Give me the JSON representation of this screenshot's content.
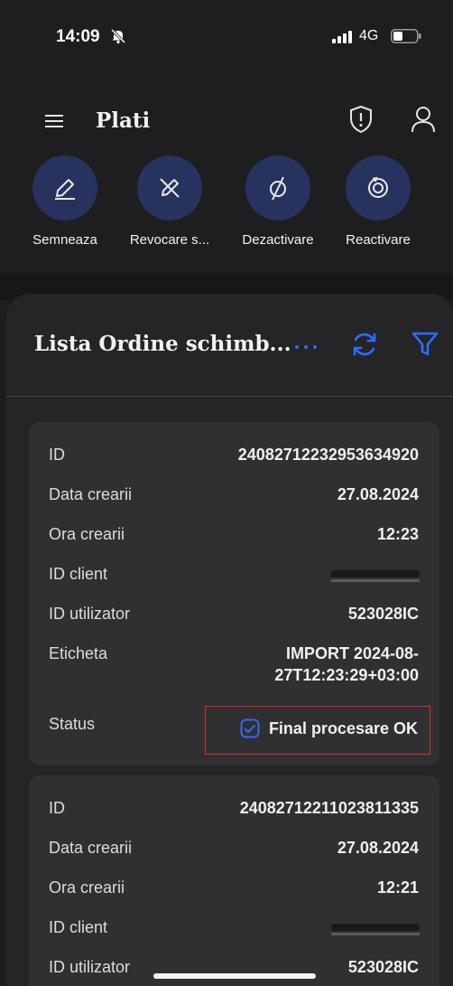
{
  "status_bar": {
    "time": "14:09",
    "network": "4G"
  },
  "header": {
    "title": "Plati"
  },
  "actions": [
    {
      "label": "Semneaza",
      "icon": "pen-icon"
    },
    {
      "label": "Revocare s...",
      "icon": "pen-cross-icon"
    },
    {
      "label": "Dezactivare",
      "icon": "disable-icon"
    },
    {
      "label": "Reactivare",
      "icon": "reactivate-icon"
    }
  ],
  "list": {
    "title": "Lista Ordine schimb...",
    "more": "···"
  },
  "orders": [
    {
      "rows": [
        {
          "key": "ID",
          "value": "24082712232953634920"
        },
        {
          "key": "Data crearii",
          "value": "27.08.2024"
        },
        {
          "key": "Ora crearii",
          "value": "12:23"
        },
        {
          "key": "ID client",
          "value": ""
        },
        {
          "key": "ID utilizator",
          "value": "523028IC"
        },
        {
          "key": "Eticheta",
          "value": "IMPORT 2024-08-",
          "value_line2": "27T12:23:29+03:00"
        },
        {
          "key": "Status",
          "value": "Final procesare OK"
        }
      ]
    },
    {
      "rows": [
        {
          "key": "ID",
          "value": "24082712211023811335"
        },
        {
          "key": "Data crearii",
          "value": "27.08.2024"
        },
        {
          "key": "Ora crearii",
          "value": "12:21"
        },
        {
          "key": "ID client",
          "value": ""
        },
        {
          "key": "ID utilizator",
          "value": "523028IC"
        }
      ]
    }
  ],
  "colors": {
    "background": "#1e1e20",
    "accent": "#2f6bff",
    "action_circle": "#27325e",
    "highlight": "#d2322a"
  }
}
